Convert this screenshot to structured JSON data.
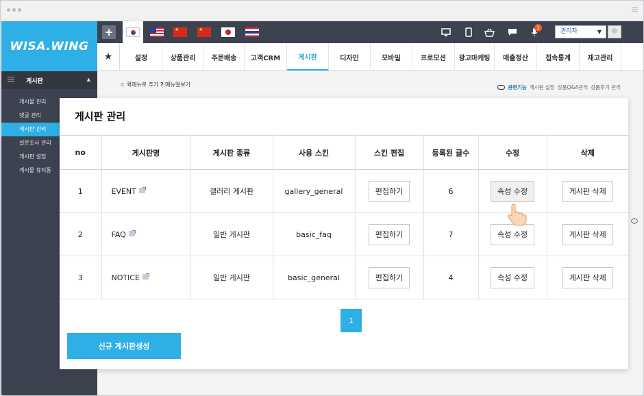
{
  "brand": {
    "logo_text": "WISA.WING",
    "accent": "#2eb0e6",
    "dark": "#3d4250"
  },
  "topbar": {
    "plus_label": "+",
    "flags": [
      "korea-flag",
      "usa-flag",
      "china-flag",
      "china-flag",
      "japan-flag",
      "thailand-flag"
    ],
    "icons": [
      "monitor-icon",
      "mobile-icon",
      "basket-icon",
      "chat-icon",
      "mic-icon"
    ],
    "notification_count": "1",
    "admin_label": "관리자"
  },
  "nav": {
    "tabs": [
      {
        "label": "설정"
      },
      {
        "label": "상품관리"
      },
      {
        "label": "주문배송"
      },
      {
        "label": "고객CRM"
      },
      {
        "label": "게시판"
      },
      {
        "label": "디자인"
      },
      {
        "label": "모바일"
      },
      {
        "label": "프로모션"
      },
      {
        "label": "광고마케팅"
      },
      {
        "label": "매출정산"
      },
      {
        "label": "접속통계"
      },
      {
        "label": "재고관리"
      }
    ],
    "active": "게시판"
  },
  "sidebar": {
    "header": "게시판",
    "items": [
      {
        "label": "게시물 관리"
      },
      {
        "label": "댓글 관리"
      },
      {
        "label": "게시판 관리"
      },
      {
        "label": "설문조사 관리"
      },
      {
        "label": "게시판 설정"
      },
      {
        "label": "게시물 휴지통"
      }
    ]
  },
  "quickbar": {
    "add_quick": "퀵메뉴로 추가",
    "manual": "메뉴얼보기"
  },
  "related": {
    "label": "관련기능",
    "links": [
      "게시판 설정",
      "상품Q&A관리",
      "상품후기 관리"
    ]
  },
  "panel": {
    "title": "게시판 관리",
    "columns": [
      "no",
      "게시판명",
      "게시판 종류",
      "사용 스킨",
      "스킨 편집",
      "등록된 글수",
      "수정",
      "삭제"
    ],
    "rows": [
      {
        "no": "1",
        "name": "EVENT",
        "type": "갤러리 게시판",
        "skin": "gallery_general",
        "edit_skin": "편집하기",
        "count": "6",
        "modify": "속성 수정",
        "delete": "게시판 삭제"
      },
      {
        "no": "2",
        "name": "FAQ",
        "type": "일반 게시판",
        "skin": "basic_faq",
        "edit_skin": "편집하기",
        "count": "7",
        "modify": "속성 수정",
        "delete": "게시판 삭제"
      },
      {
        "no": "3",
        "name": "NOTICE",
        "type": "일반 게시판",
        "skin": "basic_general",
        "edit_skin": "편집하기",
        "count": "4",
        "modify": "속성 수정",
        "delete": "게시판 삭제"
      }
    ],
    "page": "1",
    "create_button": "신규 게시판생성"
  }
}
